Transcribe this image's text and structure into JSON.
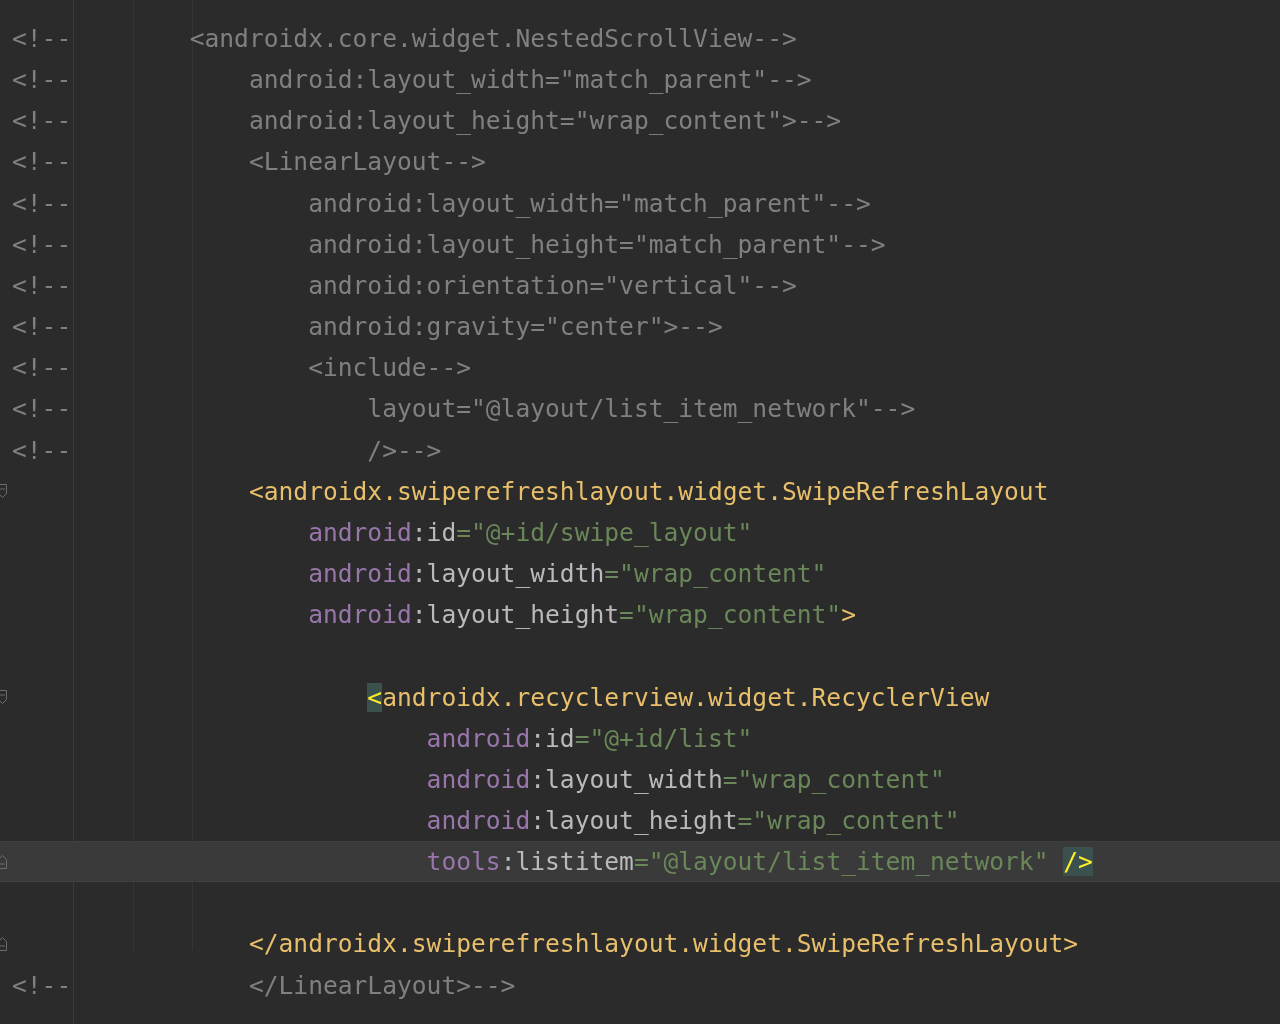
{
  "editor": {
    "lines": [
      {
        "kind": "code",
        "comment_mark": "<!--",
        "tokens": [
          {
            "kind": "comment",
            "text": "<androidx.core.widget.NestedScrollView-->"
          }
        ],
        "children": [
          {
            "kind": "code",
            "comment_mark": "<!--",
            "tokens": [
              {
                "kind": "comment",
                "text": "android:layout_width=\"match_parent\"-->"
              }
            ]
          },
          {
            "kind": "code",
            "comment_mark": "<!--",
            "tokens": [
              {
                "kind": "comment",
                "text": "android:layout_height=\"wrap_content\">-->"
              }
            ]
          },
          {
            "kind": "code",
            "comment_mark": "<!--",
            "tokens": [
              {
                "kind": "comment",
                "text": "<LinearLayout-->"
              }
            ],
            "children": [
              {
                "kind": "code",
                "comment_mark": "<!--",
                "tokens": [
                  {
                    "kind": "comment",
                    "text": "android:layout_width=\"match_parent\"-->"
                  }
                ]
              },
              {
                "kind": "code",
                "comment_mark": "<!--",
                "tokens": [
                  {
                    "kind": "comment",
                    "text": "android:layout_height=\"match_parent\"-->"
                  }
                ]
              },
              {
                "kind": "code",
                "comment_mark": "<!--",
                "tokens": [
                  {
                    "kind": "comment",
                    "text": "android:orientation=\"vertical\"-->"
                  }
                ]
              },
              {
                "kind": "code",
                "comment_mark": "<!--",
                "tokens": [
                  {
                    "kind": "comment",
                    "text": "android:gravity=\"center\">-->"
                  }
                ]
              },
              {
                "kind": "code",
                "comment_mark": "<!--",
                "tokens": [
                  {
                    "kind": "comment",
                    "text": "<include-->"
                  }
                ],
                "children": [
                  {
                    "kind": "code",
                    "comment_mark": "<!--",
                    "tokens": [
                      {
                        "kind": "comment",
                        "text": "layout=\"@layout/list_item_network\"-->"
                      }
                    ]
                  },
                  {
                    "kind": "code",
                    "comment_mark": "<!--",
                    "tokens": [
                      {
                        "kind": "comment",
                        "text": "/>-->"
                      }
                    ]
                  }
                ]
              }
            ]
          },
          {
            "kind": "code",
            "fold_open": true,
            "tokens": [
              {
                "kind": "tag",
                "text": "<androidx.swiperefreshlayout.widget.SwipeRefreshLayout"
              }
            ],
            "children": [
              {
                "kind": "code",
                "tokens": [
                  {
                    "kind": "ns",
                    "text": "android"
                  },
                  {
                    "kind": "plain",
                    "text": ":id"
                  },
                  {
                    "kind": "value",
                    "text": "=\"@+id/swipe_layout\""
                  }
                ]
              },
              {
                "kind": "code",
                "tokens": [
                  {
                    "kind": "ns",
                    "text": "android"
                  },
                  {
                    "kind": "plain",
                    "text": ":layout_width"
                  },
                  {
                    "kind": "value",
                    "text": "=\"wrap_content\""
                  }
                ]
              },
              {
                "kind": "code",
                "tokens": [
                  {
                    "kind": "ns",
                    "text": "android"
                  },
                  {
                    "kind": "plain",
                    "text": ":layout_height"
                  },
                  {
                    "kind": "value",
                    "text": "=\"wrap_content\""
                  },
                  {
                    "kind": "tag",
                    "text": ">"
                  }
                ]
              },
              {
                "kind": "blank"
              },
              {
                "kind": "group",
                "children": [
                  {
                    "kind": "code",
                    "fold_open": true,
                    "tokens": [
                      {
                        "kind": "bracket",
                        "text": "<"
                      },
                      {
                        "kind": "tag",
                        "text": "androidx.recyclerview.widget.RecyclerView"
                      }
                    ],
                    "children": [
                      {
                        "kind": "code",
                        "tokens": [
                          {
                            "kind": "ns",
                            "text": "android"
                          },
                          {
                            "kind": "plain",
                            "text": ":id"
                          },
                          {
                            "kind": "value",
                            "text": "=\"@+id/list\""
                          }
                        ]
                      },
                      {
                        "kind": "code",
                        "tokens": [
                          {
                            "kind": "ns",
                            "text": "android"
                          },
                          {
                            "kind": "plain",
                            "text": ":layout_width"
                          },
                          {
                            "kind": "value",
                            "text": "=\"wrap_content\""
                          }
                        ]
                      },
                      {
                        "kind": "code",
                        "tokens": [
                          {
                            "kind": "ns",
                            "text": "android"
                          },
                          {
                            "kind": "plain",
                            "text": ":layout_height"
                          },
                          {
                            "kind": "value",
                            "text": "=\"wrap_content\""
                          }
                        ]
                      },
                      {
                        "kind": "code",
                        "current": true,
                        "fold_close": true,
                        "tokens": [
                          {
                            "kind": "ns",
                            "text": "tools"
                          },
                          {
                            "kind": "plain",
                            "text": ":listitem"
                          },
                          {
                            "kind": "value",
                            "text": "=\"@layout/list_item_network\" "
                          },
                          {
                            "kind": "bracket",
                            "text": "/>"
                          }
                        ]
                      }
                    ]
                  }
                ]
              },
              {
                "kind": "blank"
              }
            ]
          },
          {
            "kind": "code",
            "fold_close": true,
            "tokens": [
              {
                "kind": "tag",
                "text": "</androidx.swiperefreshlayout.widget.SwipeRefreshLayout>"
              }
            ]
          },
          {
            "kind": "code",
            "comment_mark": "<!--",
            "tokens": [
              {
                "kind": "comment",
                "text": "</LinearLayout>-->"
              }
            ]
          }
        ]
      }
    ]
  }
}
